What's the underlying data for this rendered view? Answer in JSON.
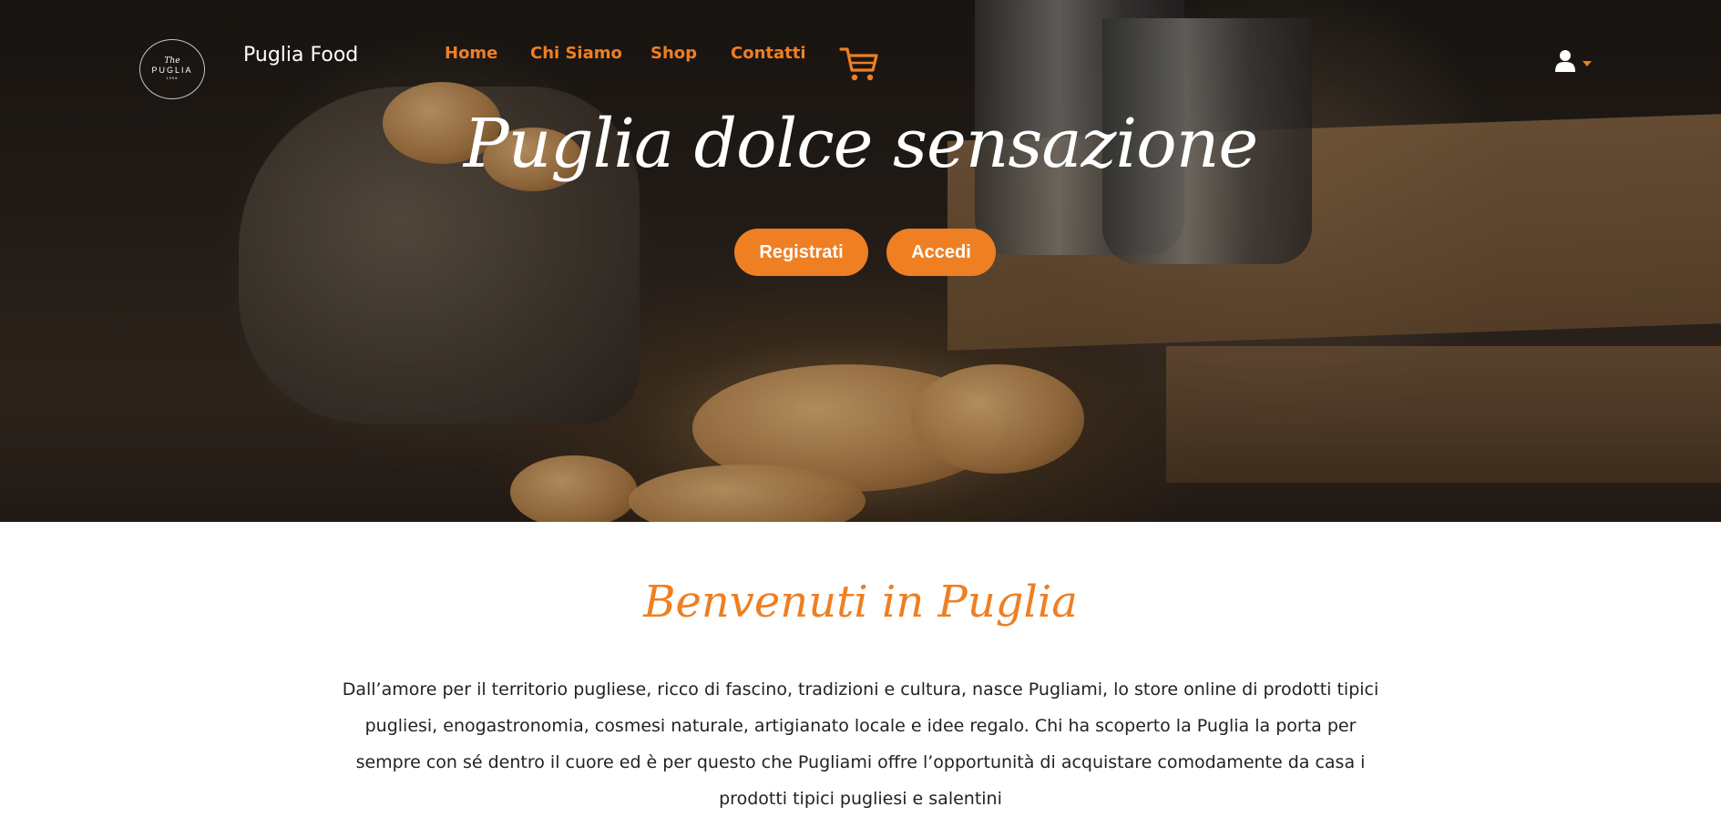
{
  "brand": {
    "logo_top": "The",
    "logo_main": "PUGLIA",
    "logo_sub": "1996",
    "name": "Puglia Food"
  },
  "nav": {
    "items": [
      {
        "label": "Home"
      },
      {
        "label": "Chi Siamo"
      },
      {
        "label": "Shop"
      },
      {
        "label": "Contatti"
      }
    ],
    "cart_icon": "shopping-cart-icon",
    "user_icon": "user-icon",
    "accent": "#ee7f22"
  },
  "hero": {
    "title": "Puglia dolce sensazione",
    "buttons": {
      "register": "Registrati",
      "login": "Accedi"
    }
  },
  "welcome": {
    "title": "Benvenuti in Puglia",
    "text": "Dall’amore per il territorio pugliese, ricco di fascino, tradizioni e cultura, nasce Pugliami, lo store online di prodotti tipici pugliesi, enogastronomia, cosmesi naturale, artigianato locale e idee regalo. Chi ha scoperto la Puglia la porta per sempre con sé dentro il cuore ed è per questo che Pugliami offre l’opportunità di acquistare comodamente da casa i prodotti tipici pugliesi e salentini"
  }
}
